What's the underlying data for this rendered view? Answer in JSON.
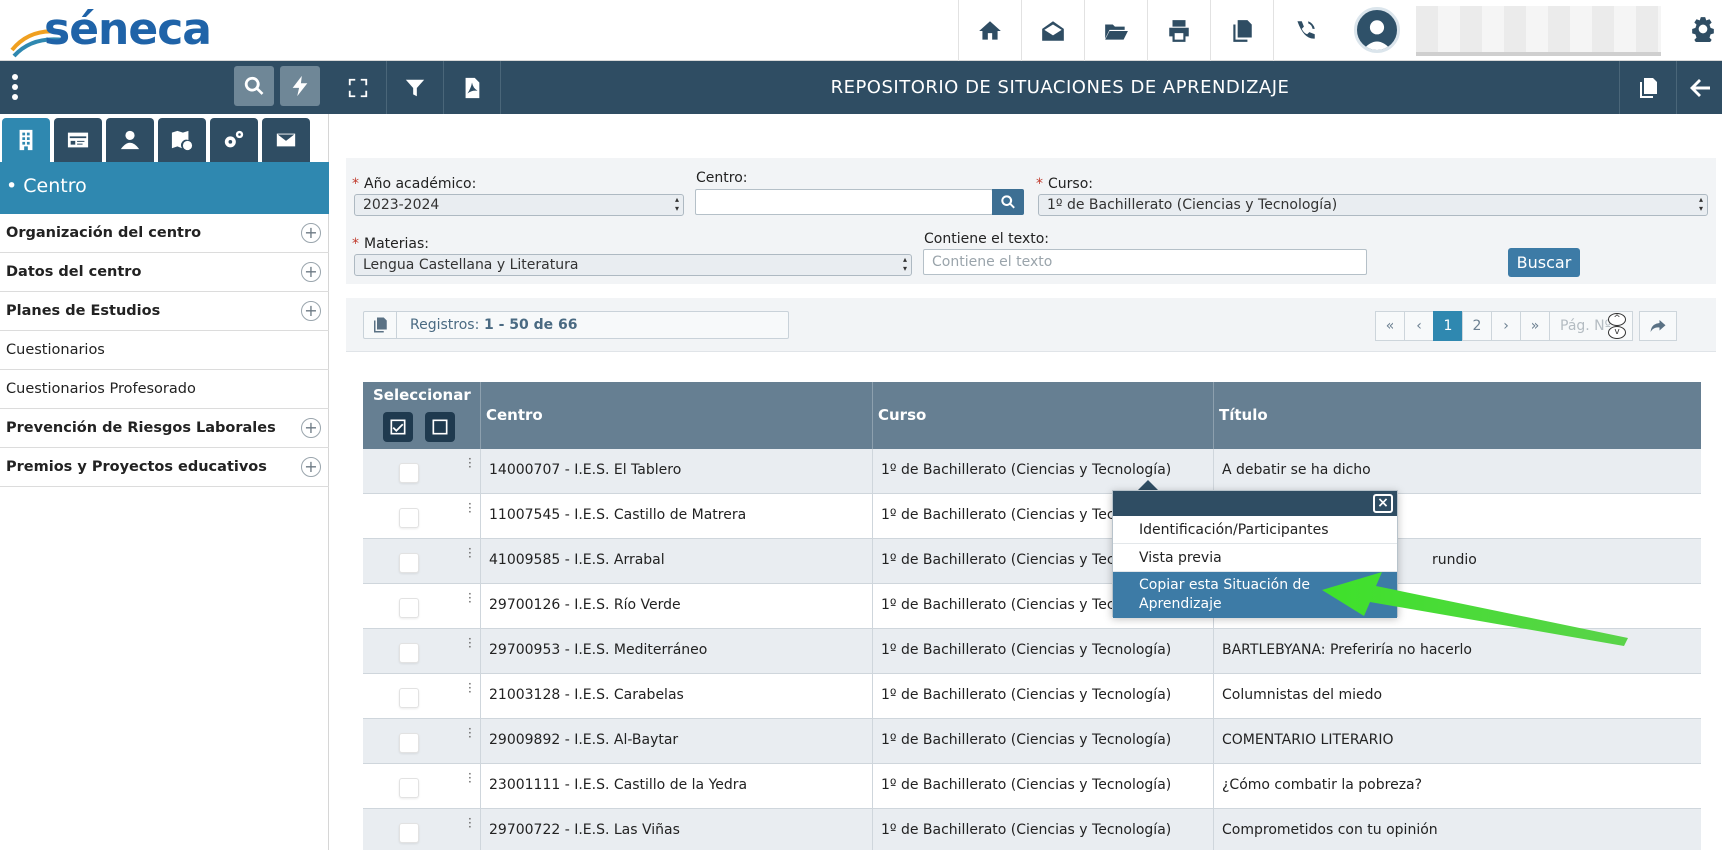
{
  "app": {
    "logo_text": "séneca",
    "page_title": "REPOSITORIO DE SITUACIONES DE APRENDIZAJE"
  },
  "topbar_icons": [
    "home-icon",
    "envelope-open-icon",
    "folder-open-icon",
    "print-icon",
    "copy-icon",
    "phone-volume-icon"
  ],
  "sidebar": {
    "section_title": "• Centro",
    "items": [
      {
        "label": "Organización del centro",
        "bold": true,
        "expandable": true
      },
      {
        "label": "Datos del centro",
        "bold": true,
        "expandable": true
      },
      {
        "label": "Planes de Estudios",
        "bold": true,
        "expandable": true
      },
      {
        "label": "Cuestionarios",
        "bold": false,
        "expandable": false
      },
      {
        "label": "Cuestionarios Profesorado",
        "bold": false,
        "expandable": false
      },
      {
        "label": "Prevención de Riesgos Laborales",
        "bold": true,
        "expandable": true
      },
      {
        "label": "Premios y Proyectos educativos",
        "bold": true,
        "expandable": true
      }
    ],
    "plus": "+"
  },
  "filters": {
    "anio_label": "Año académico:",
    "anio_value": "2023-2024",
    "centro_label": "Centro:",
    "centro_value": "",
    "curso_label": "Curso:",
    "curso_value": "1º de Bachillerato (Ciencias y Tecnología)",
    "materias_label": "Materias:",
    "materias_value": "Lengua Castellana y Literatura",
    "texto_label": "Contiene el texto:",
    "texto_placeholder": "Contiene el texto",
    "required_mark": "*",
    "buscar_label": "Buscar"
  },
  "records": {
    "label": "Registros:",
    "value": "1 - 50 de 66"
  },
  "pager": {
    "first": "«",
    "prev": "‹",
    "pages": [
      "1",
      "2"
    ],
    "next": "›",
    "last": "»",
    "page_placeholder": "Pág. Nº",
    "spin_up": "^",
    "spin_down": "v"
  },
  "table": {
    "headers": {
      "select": "Seleccionar",
      "centro": "Centro",
      "curso": "Curso",
      "titulo": "Título"
    },
    "rows": [
      {
        "centro": "14000707 - I.E.S. El Tablero",
        "curso": "1º de Bachillerato (Ciencias y Tecnología)",
        "titulo": "A debatir se ha dicho"
      },
      {
        "centro": "11007545 - I.E.S. Castillo de Matrera",
        "curso": "1º de Bachillerato (Ciencias y Tecnología)",
        "titulo": ""
      },
      {
        "centro": "41009585 - I.E.S. Arrabal",
        "curso": "1º de Bachillerato (Ciencias y Tecnología)",
        "titulo": "rundio"
      },
      {
        "centro": "29700126 - I.E.S. Río Verde",
        "curso": "1º de Bachillerato (Ciencias y Tecnología)",
        "titulo": ""
      },
      {
        "centro": "29700953 - I.E.S. Mediterráneo",
        "curso": "1º de Bachillerato (Ciencias y Tecnología)",
        "titulo": "BARTLEBYANA: Preferiría no hacerlo"
      },
      {
        "centro": "21003128 - I.E.S. Carabelas",
        "curso": "1º de Bachillerato (Ciencias y Tecnología)",
        "titulo": "Columnistas del miedo"
      },
      {
        "centro": "29009892 - I.E.S. Al-Baytar",
        "curso": "1º de Bachillerato (Ciencias y Tecnología)",
        "titulo": "COMENTARIO LITERARIO"
      },
      {
        "centro": "23001111 - I.E.S. Castillo de la Yedra",
        "curso": "1º de Bachillerato (Ciencias y Tecnología)",
        "titulo": "¿Cómo combatir la pobreza?"
      },
      {
        "centro": "29700722 - I.E.S. Las Viñas",
        "curso": "1º de Bachillerato (Ciencias y Tecnología)",
        "titulo": "Comprometidos con tu opinión"
      }
    ]
  },
  "popup": {
    "close": "×",
    "items": [
      "Identificación/Participantes",
      "Vista previa",
      "Copiar esta Situación de Aprendizaje"
    ]
  },
  "colors": {
    "dark": "#2f4d63",
    "accent": "#2f88b0",
    "highlight": "#3d7ba6",
    "arrow": "#3ee12a"
  }
}
